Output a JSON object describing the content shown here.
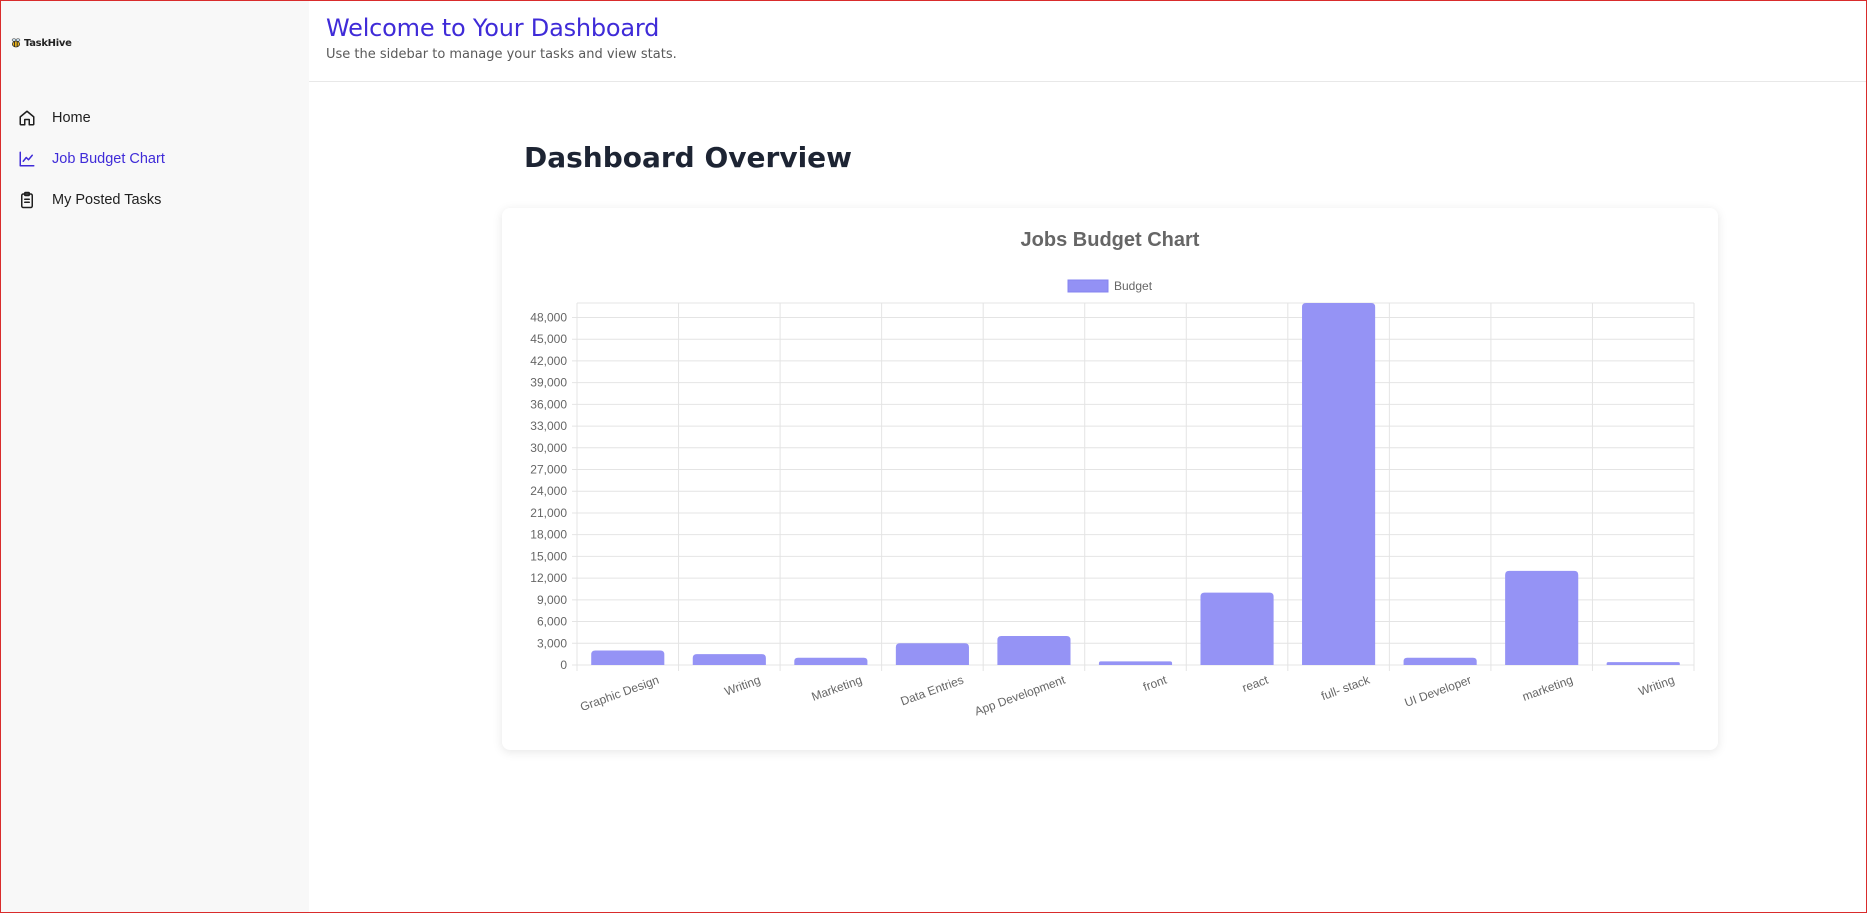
{
  "app": {
    "logo_text": "TaskHive",
    "brand_color": "#3f2bd8"
  },
  "sidebar": {
    "items": [
      {
        "label": "Home",
        "icon": "home-icon",
        "active": false
      },
      {
        "label": "Job Budget Chart",
        "icon": "line-chart-icon",
        "active": true
      },
      {
        "label": "My Posted Tasks",
        "icon": "clipboard-icon",
        "active": false
      }
    ]
  },
  "header": {
    "title": "Welcome to Your Dashboard",
    "subtitle": "Use the sidebar to manage your tasks and view stats."
  },
  "main": {
    "title": "Dashboard Overview"
  },
  "chart_data": {
    "type": "bar",
    "title": "Jobs Budget Chart",
    "categories": [
      "Graphic Design",
      "Writing",
      "Marketing",
      "Data Entries",
      "App Development",
      "front",
      "react",
      "full- stack",
      "UI Developer",
      "marketing",
      "Writing"
    ],
    "series": [
      {
        "name": "Budget",
        "values": [
          2000,
          1500,
          1000,
          3000,
          4000,
          500,
          10000,
          50000,
          1000,
          13000,
          400
        ],
        "color": "#9391f5"
      }
    ],
    "ylim": [
      0,
      50000
    ],
    "yticks": [
      "0",
      "3,000",
      "6,000",
      "9,000",
      "12,000",
      "15,000",
      "18,000",
      "21,000",
      "24,000",
      "27,000",
      "30,000",
      "33,000",
      "36,000",
      "39,000",
      "42,000",
      "45,000",
      "48,000"
    ],
    "legend": "top",
    "grid": true
  }
}
